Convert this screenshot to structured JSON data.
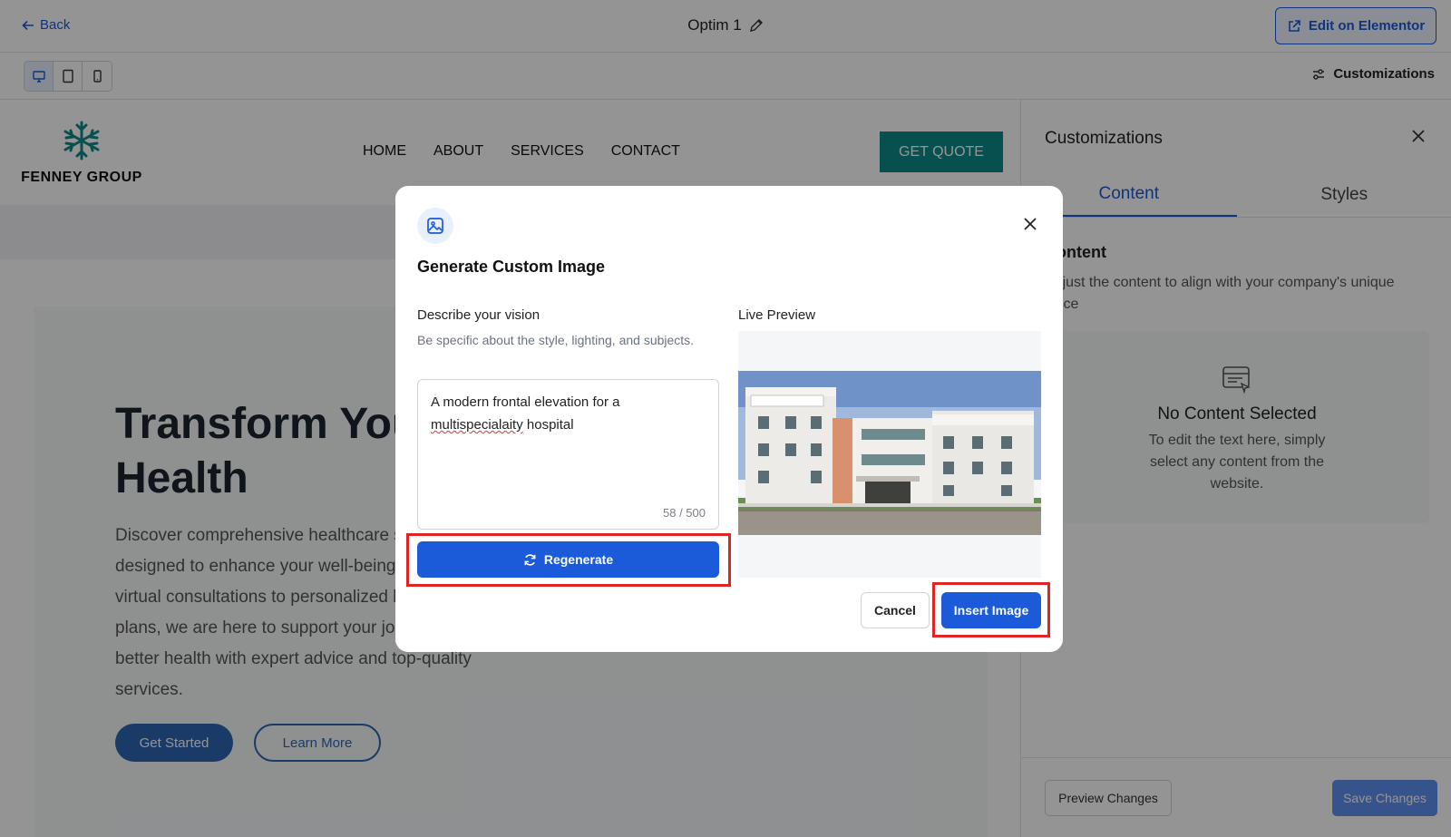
{
  "topbar": {
    "back_label": "Back",
    "doc_title": "Optim 1",
    "edit_label": "Edit on Elementor"
  },
  "toolbar": {
    "devices": [
      "desktop",
      "tablet",
      "mobile"
    ],
    "customizations_label": "Customizations"
  },
  "site": {
    "logo_text": "FENNEY GROUP",
    "nav": [
      "HOME",
      "ABOUT",
      "SERVICES",
      "CONTACT"
    ],
    "cta": "GET QUOTE",
    "hero_title": "Transform Your Health",
    "hero_sub": "Discover comprehensive healthcare solutions designed to enhance your well-being. From virtual consultations to personalized health plans, we are here to support your journey to better health with expert advice and top-quality services.",
    "btn_start": "Get Started",
    "btn_learn": "Learn More"
  },
  "panel": {
    "title": "Customizations",
    "tabs": [
      "Content",
      "Styles"
    ],
    "section_title": "Content",
    "section_desc": "Adjust the content to align with your company's unique voice",
    "empty_title": "No Content Selected",
    "empty_desc": "To edit the text here, simply select any content from the website.",
    "preview_btn": "Preview Changes",
    "save_btn": "Save Changes"
  },
  "modal": {
    "title": "Generate Custom Image",
    "desc_label": "Describe your vision",
    "desc_help": "Be specific about the style, lighting, and subjects.",
    "prompt_pre": "A modern frontal elevation for a ",
    "prompt_misspelled": "multispecialaity",
    "prompt_post": " hospital",
    "counter": "58 / 500",
    "regenerate": "Regenerate",
    "preview_label": "Live Preview",
    "cancel": "Cancel",
    "insert": "Insert Image"
  },
  "colors": {
    "accent": "#1b5ad8",
    "brand_teal": "#0f8a8a",
    "highlight": "#e02424"
  }
}
